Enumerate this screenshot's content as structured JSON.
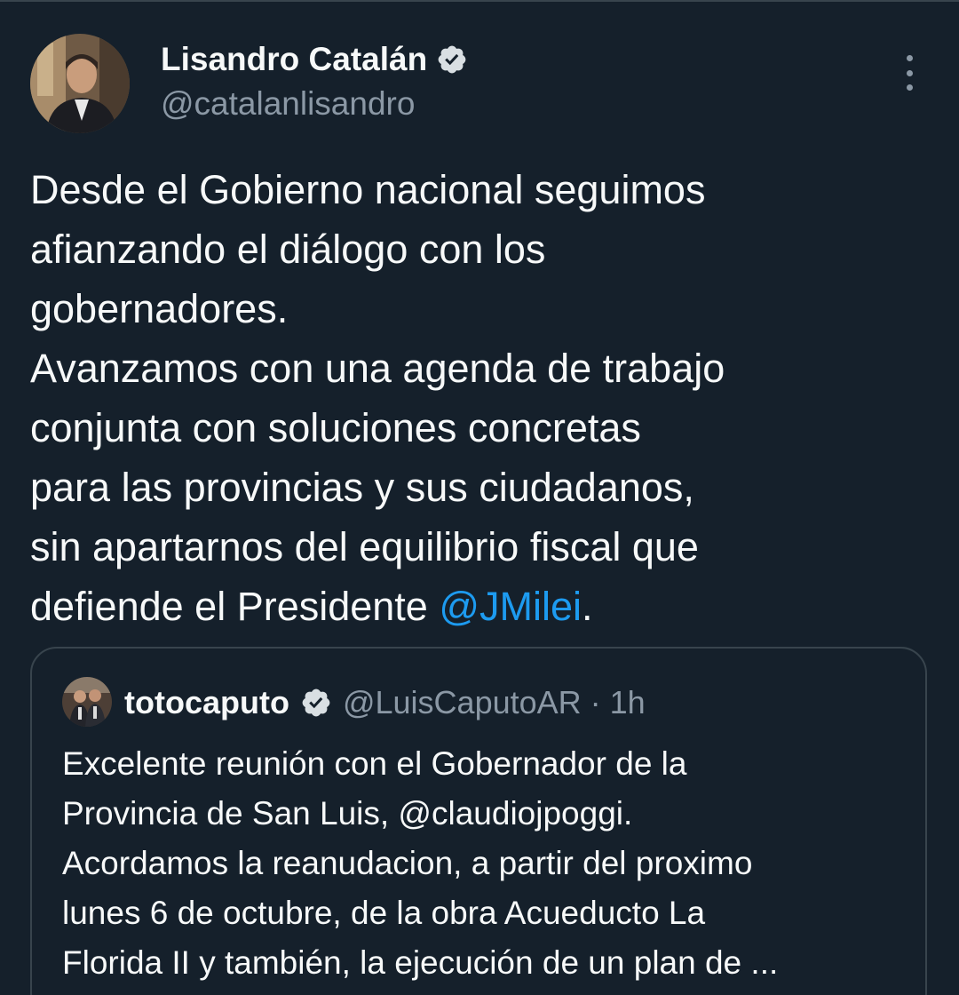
{
  "author": {
    "name": "Lisandro Catalán",
    "handle": "@catalanlisandro",
    "verified": true
  },
  "more_icon": "more-vertical-icon",
  "tweet": {
    "lines": [
      "Desde el Gobierno nacional seguimos",
      "afianzando el diálogo con los",
      "gobernadores.",
      "Avanzamos con una agenda de trabajo",
      "conjunta con soluciones concretas",
      "para las provincias y sus ciudadanos,",
      "sin apartarnos del equilibrio fiscal que"
    ],
    "last_line_prefix": "defiende el Presidente ",
    "mention": "@JMilei",
    "last_line_suffix": "."
  },
  "quote": {
    "name": "totocaputo",
    "handle": "@LuisCaputoAR",
    "separator": "·",
    "time": "1h",
    "verified": true,
    "lines": [
      "Excelente reunión con el Gobernador de la",
      "Provincia de San Luis, @claudiojpoggi.",
      "Acordamos  la reanudacion, a partir del proximo",
      "lunes 6 de octubre, de la obra Acueducto La",
      "Florida II y también, la ejecución de un plan de ..."
    ]
  },
  "colors": {
    "background": "#15202b",
    "text": "#f7f9f9",
    "secondary": "#8b98a5",
    "link": "#1d9bf0",
    "border": "#38444d"
  }
}
